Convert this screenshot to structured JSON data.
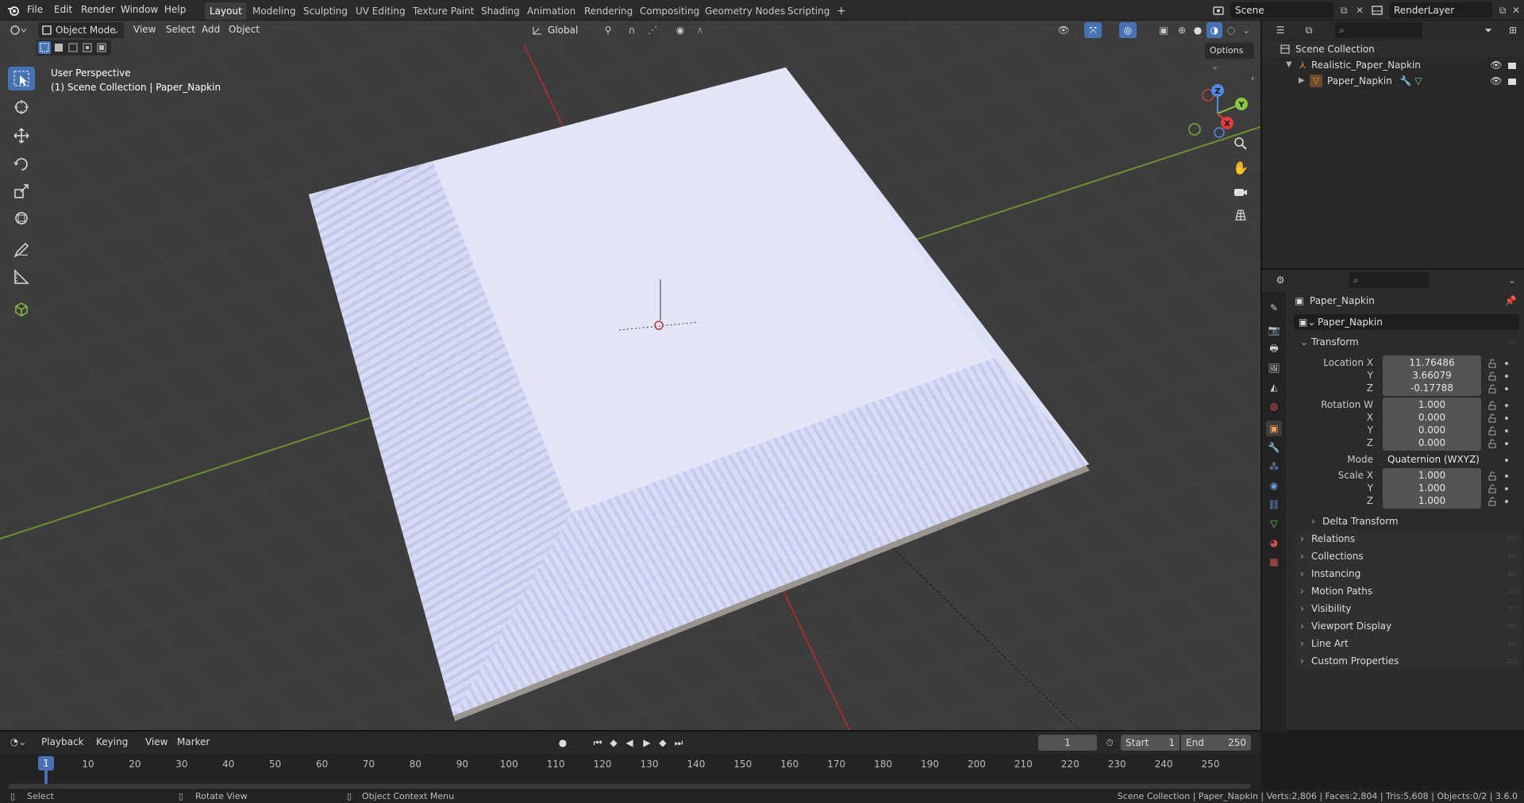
{
  "topbar": {
    "menus": [
      "File",
      "Edit",
      "Render",
      "Window",
      "Help"
    ],
    "workspaces": [
      "Layout",
      "Modeling",
      "Sculpting",
      "UV Editing",
      "Texture Paint",
      "Shading",
      "Animation",
      "Rendering",
      "Compositing",
      "Geometry Nodes",
      "Scripting"
    ],
    "add_tab": "+",
    "scene": "Scene",
    "view_layer": "RenderLayer"
  },
  "viewport": {
    "mode": "Object Mode",
    "menus": [
      "View",
      "Select",
      "Add",
      "Object"
    ],
    "orientation": "Global",
    "options": "Options",
    "perspective": "User Perspective",
    "collection_info": "(1) Scene Collection | Paper_Napkin",
    "gizmo": {
      "x": "X",
      "y": "Y",
      "z": "Z"
    }
  },
  "outliner": {
    "root": "Scene Collection",
    "items": [
      "Realistic_Paper_Napkin",
      "Paper_Napkin"
    ]
  },
  "properties": {
    "object_name": "Paper_Napkin",
    "data_name": "Paper_Napkin",
    "transform_header": "Transform",
    "location_label": "Location X",
    "loc": {
      "x": "11.76486",
      "y": "3.66079",
      "z": "-0.17788"
    },
    "rotation_label": "Rotation W",
    "rot": {
      "w": "1.000",
      "x": "0.000",
      "y": "0.000",
      "z": "0.000"
    },
    "mode_label": "Mode",
    "mode_value": "Quaternion (WXYZ)",
    "scale_label": "Scale X",
    "scale": {
      "x": "1.000",
      "y": "1.000",
      "z": "1.000"
    },
    "axis": {
      "y": "Y",
      "z": "Z",
      "x": "X"
    },
    "delta": "Delta Transform",
    "panels": [
      "Relations",
      "Collections",
      "Instancing",
      "Motion Paths",
      "Visibility",
      "Viewport Display",
      "Line Art",
      "Custom Properties"
    ]
  },
  "timeline": {
    "menus": [
      "Playback",
      "Keying",
      "View",
      "Marker"
    ],
    "current_frame": "1",
    "start_label": "Start",
    "start": "1",
    "end_label": "End",
    "end": "250",
    "ticks": [
      "1",
      "10",
      "20",
      "30",
      "40",
      "50",
      "60",
      "70",
      "80",
      "90",
      "100",
      "110",
      "120",
      "130",
      "140",
      "150",
      "160",
      "170",
      "180",
      "190",
      "200",
      "210",
      "220",
      "230",
      "240",
      "250"
    ]
  },
  "statusbar": {
    "select": "Select",
    "rotate": "Rotate View",
    "context": "Object Context Menu",
    "stats": "Scene Collection | Paper_Napkin | Verts:2,806 | Faces:2,804 | Tris:5,608 | Objects:0/2 | 3.6.0"
  },
  "colors": {
    "accent": "#4772b3",
    "x_axis": "#e23c3c",
    "y_axis": "#8bc63f",
    "z_axis": "#4f8ae5",
    "panel_bg": "#2b2b2b",
    "viewport_bg": "#3d3d3d"
  }
}
